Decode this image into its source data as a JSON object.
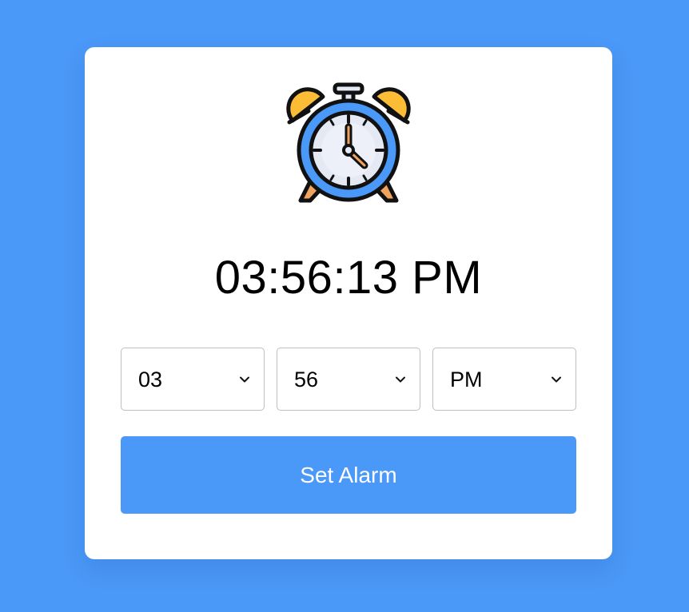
{
  "clock": {
    "icon": "alarm-clock-icon",
    "current_time": "03:56:13 PM"
  },
  "alarm": {
    "hour": "03",
    "minute": "56",
    "period": "PM",
    "chevron_icon": "chevron-down-icon"
  },
  "actions": {
    "set_alarm_label": "Set Alarm"
  },
  "colors": {
    "background": "#4a98f7",
    "card": "#ffffff",
    "accent": "#4a98f7",
    "bell": "#fcbc35",
    "clock_face": "#e4e9f4",
    "clock_rim": "#4a98f7",
    "legs": "#f0a35e"
  }
}
